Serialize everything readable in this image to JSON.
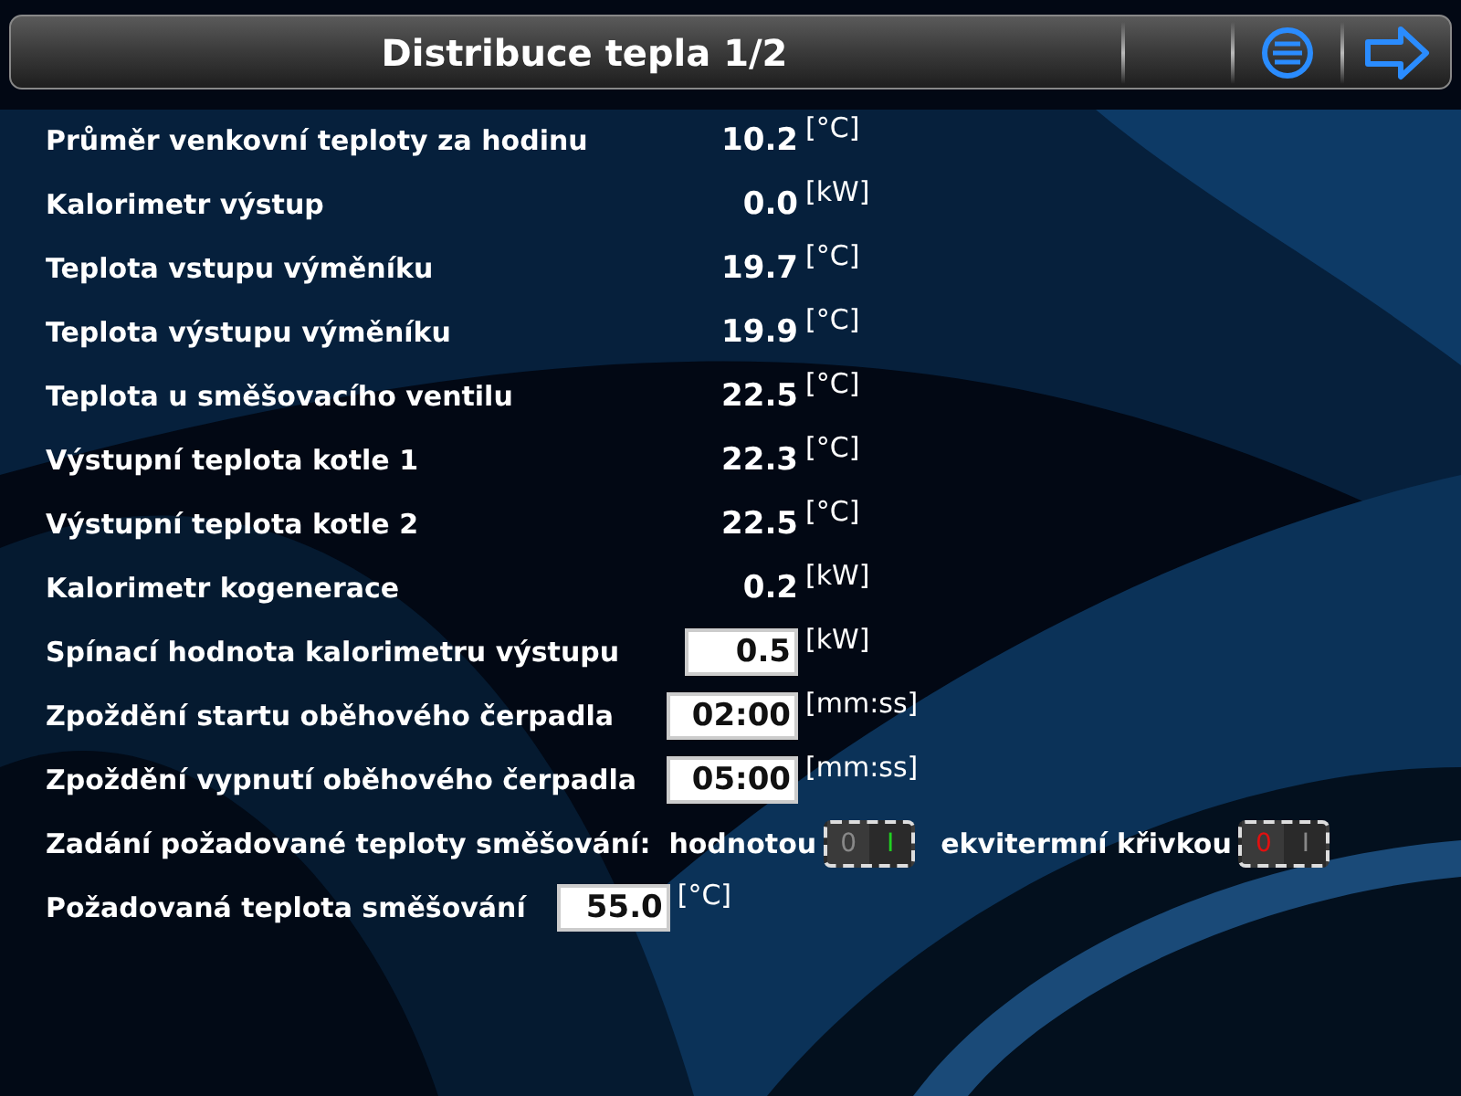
{
  "header": {
    "title": "Distribuce tepla 1/2"
  },
  "rows": [
    {
      "kind": "readout",
      "label": "Průměr venkovní teploty za hodinu",
      "value": "10.2",
      "unit": "[°C]"
    },
    {
      "kind": "readout",
      "label": "Kalorimetr výstup",
      "value": "0.0",
      "unit": "[kW]"
    },
    {
      "kind": "readout",
      "label": "Teplota vstupu výměníku",
      "value": "19.7",
      "unit": "[°C]"
    },
    {
      "kind": "readout",
      "label": "Teplota výstupu výměníku",
      "value": "19.9",
      "unit": "[°C]"
    },
    {
      "kind": "readout",
      "label": "Teplota u směšovacího ventilu",
      "value": "22.5",
      "unit": "[°C]"
    },
    {
      "kind": "readout",
      "label": "Výstupní teplota kotle 1",
      "value": "22.3",
      "unit": "[°C]"
    },
    {
      "kind": "readout",
      "label": "Výstupní teplota kotle 2",
      "value": "22.5",
      "unit": "[°C]"
    },
    {
      "kind": "readout",
      "label": "Kalorimetr kogenerace",
      "value": "0.2",
      "unit": "[kW]"
    },
    {
      "kind": "input",
      "label": "Spínací hodnota kalorimetru výstupu",
      "value": "0.5",
      "unit": "[kW]"
    },
    {
      "kind": "input",
      "label": "Zpoždění startu oběhového čerpadla",
      "value": "02:00",
      "unit": "[mm:ss]"
    },
    {
      "kind": "input",
      "label": "Zpoždění vypnutí oběhového čerpadla",
      "value": "05:00",
      "unit": "[mm:ss]"
    },
    {
      "kind": "toggles",
      "label": "Zadání požadované teploty směšování:",
      "toggles": [
        {
          "label": "hodnotou",
          "on": true,
          "off_text": "0",
          "on_text": "I"
        },
        {
          "label": "ekvitermní křivkou",
          "on": false,
          "off_text": "0",
          "on_text": "I"
        }
      ]
    },
    {
      "kind": "inline-input",
      "label": "Požadovaná teplota směšování",
      "value": "55.0",
      "unit": "[°C]"
    }
  ]
}
